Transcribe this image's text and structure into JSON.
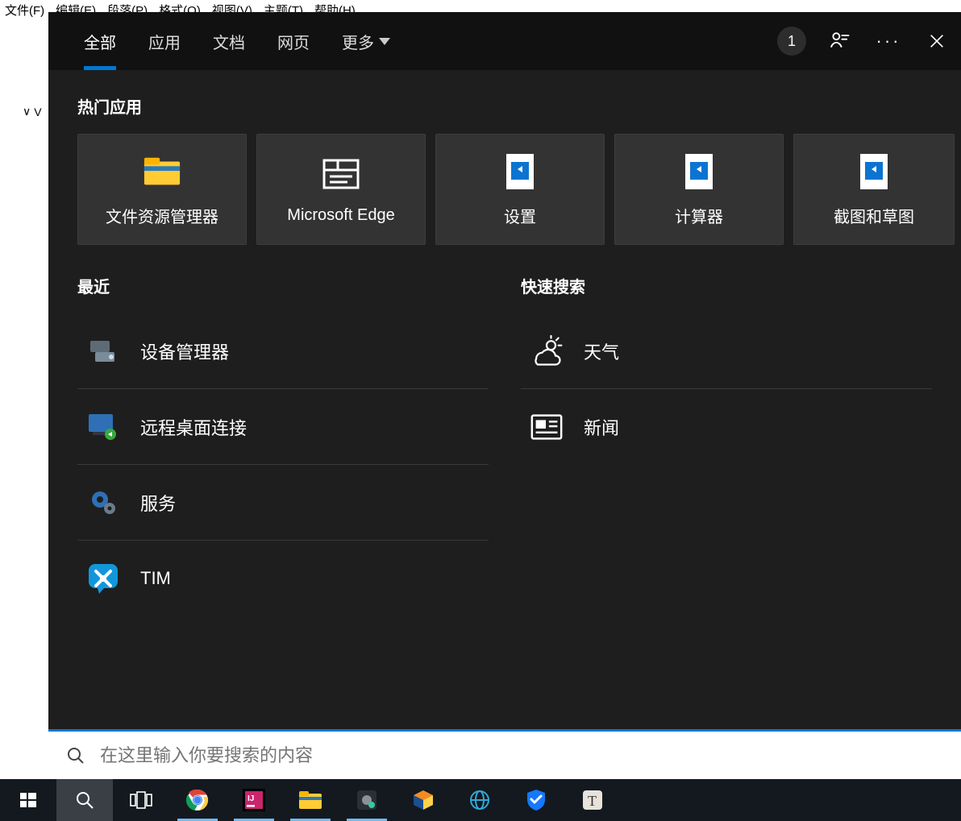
{
  "bg_menu": {
    "items": [
      "文件(F)",
      "编辑(E)",
      "段落(P)",
      "格式(O)",
      "视图(V)",
      "主题(T)",
      "帮助(H)"
    ]
  },
  "bg_tree": {
    "caret": "∨",
    "label": "V"
  },
  "overlay": {
    "tabs": {
      "all": "全部",
      "apps": "应用",
      "docs": "文档",
      "web": "网页",
      "more": "更多"
    },
    "badge": "1",
    "sections": {
      "top_title": "热门应用",
      "recent_title": "最近",
      "quick_title": "快速搜索"
    },
    "top_tiles": [
      {
        "label": "文件资源管理器",
        "icon": "file-explorer"
      },
      {
        "label": "Microsoft Edge",
        "icon": "edge"
      },
      {
        "label": "设置",
        "icon": "settings-tile"
      },
      {
        "label": "计算器",
        "icon": "calculator"
      },
      {
        "label": "截图和草图",
        "icon": "snip"
      }
    ],
    "recent": [
      {
        "label": "设备管理器",
        "icon": "device-manager"
      },
      {
        "label": "远程桌面连接",
        "icon": "remote-desktop"
      },
      {
        "label": "服务",
        "icon": "services"
      },
      {
        "label": "TIM",
        "icon": "tim"
      }
    ],
    "quick": [
      {
        "label": "天气",
        "icon": "weather"
      },
      {
        "label": "新闻",
        "icon": "news"
      }
    ],
    "search_placeholder": "在这里输入你要搜索的内容"
  },
  "taskbar": {
    "buttons": [
      {
        "name": "start-button",
        "icon": "windows"
      },
      {
        "name": "search-button",
        "icon": "search",
        "active": true
      },
      {
        "name": "taskview-button",
        "icon": "taskview"
      },
      {
        "name": "chrome-button",
        "icon": "chrome",
        "running": true
      },
      {
        "name": "intellij-button",
        "icon": "intellij",
        "running": true
      },
      {
        "name": "file-explorer-button",
        "icon": "file-explorer",
        "running": true
      },
      {
        "name": "app-dark-button",
        "icon": "darkcube",
        "running": true
      },
      {
        "name": "virtualbox-button",
        "icon": "virtualbox"
      },
      {
        "name": "browser-globe-button",
        "icon": "globe"
      },
      {
        "name": "tencent-guard-button",
        "icon": "shield"
      },
      {
        "name": "typora-button",
        "icon": "typora"
      }
    ]
  }
}
